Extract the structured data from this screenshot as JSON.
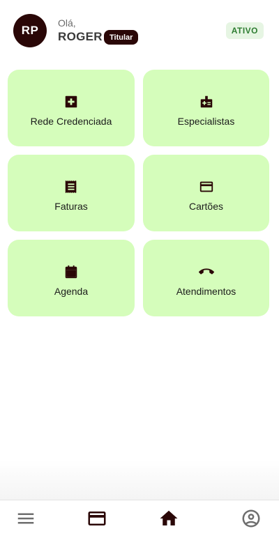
{
  "header": {
    "avatar_initials": "RP",
    "greeting": "Olá,",
    "username": "ROGER",
    "role_badge": "Titular",
    "status_badge": "ATIVO"
  },
  "colors": {
    "tile_background": "#d5fdbb",
    "brand_dark": "#2a0707",
    "status_green": "#2e7d32",
    "status_bg": "#e6f5e3"
  },
  "tiles": [
    {
      "label": "Rede Credenciada",
      "icon": "medical-plus-icon"
    },
    {
      "label": "Especialistas",
      "icon": "medical-badge-icon"
    },
    {
      "label": "Faturas",
      "icon": "receipt-icon"
    },
    {
      "label": "Cartões",
      "icon": "credit-card-icon"
    },
    {
      "label": "Agenda",
      "icon": "calendar-icon"
    },
    {
      "label": "Atendimentos",
      "icon": "phone-icon"
    }
  ],
  "bottom_nav": {
    "items": [
      {
        "icon": "menu-icon"
      },
      {
        "icon": "credit-card-icon"
      },
      {
        "icon": "home-icon"
      },
      {
        "icon": "account-icon"
      }
    ]
  }
}
